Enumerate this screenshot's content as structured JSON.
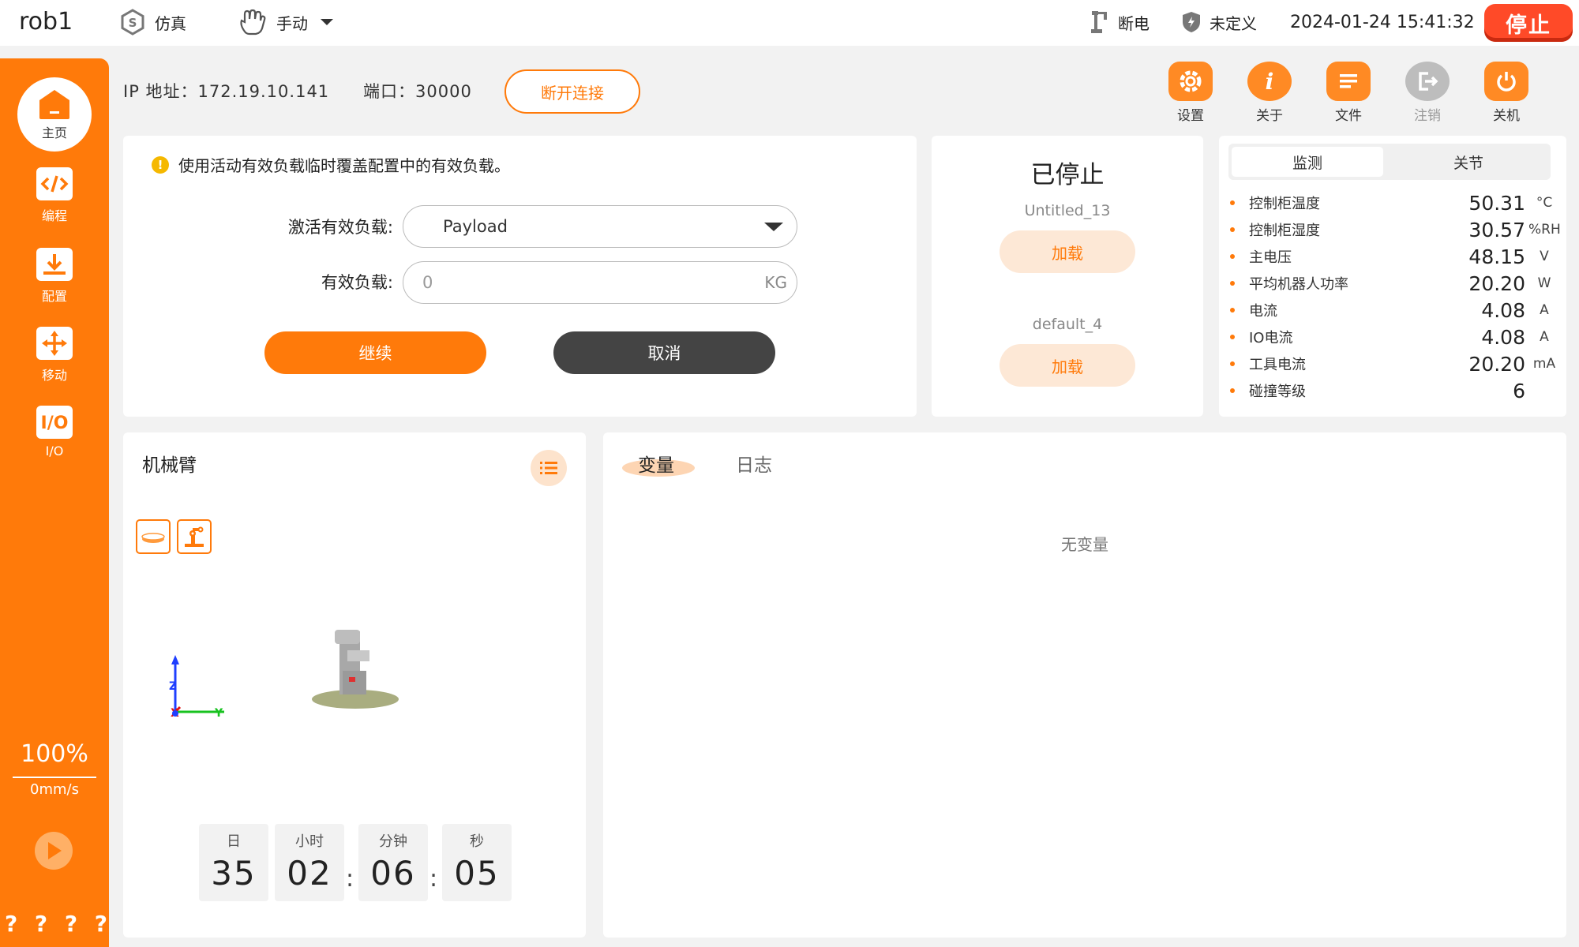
{
  "topbar": {
    "robot_name": "rob1",
    "mode": "仿真",
    "control": "手动",
    "power": "断电",
    "safety": "未定义",
    "datetime": "2024-01-24 15:41:32",
    "stop_label": "停止"
  },
  "sidebar": {
    "items": [
      {
        "label": "主页",
        "icon": "home-icon"
      },
      {
        "label": "编程",
        "icon": "code-icon"
      },
      {
        "label": "配置",
        "icon": "config-icon"
      },
      {
        "label": "移动",
        "icon": "move-icon"
      },
      {
        "label": "I/O",
        "icon": "io-icon"
      }
    ],
    "speed_percent": "100%",
    "speed_value": "0mm/s",
    "help": [
      "?",
      "?",
      "?",
      "?"
    ]
  },
  "connection": {
    "ip_label": "IP 地址：172.19.10.141",
    "port_label": "端口：30000",
    "disconnect_label": "断开连接"
  },
  "toolbar": [
    {
      "label": "设置",
      "icon": "settings-icon"
    },
    {
      "label": "关于",
      "icon": "info-icon"
    },
    {
      "label": "文件",
      "icon": "file-icon"
    },
    {
      "label": "注销",
      "icon": "logout-icon"
    },
    {
      "label": "关机",
      "icon": "power-icon"
    }
  ],
  "payload": {
    "notice": "使用活动有效负载临时覆盖配置中的有效负载。",
    "active_label": "激活有效负载:",
    "active_value": "Payload",
    "load_label": "有效负载:",
    "load_placeholder": "0",
    "load_unit": "KG",
    "continue_label": "继续",
    "cancel_label": "取消"
  },
  "program": {
    "status": "已停止",
    "items": [
      {
        "name": "Untitled_13",
        "button": "加载"
      },
      {
        "name": "default_4",
        "button": "加载"
      }
    ]
  },
  "monitor": {
    "tabs": [
      "监测",
      "关节"
    ],
    "rows": [
      {
        "label": "控制柜温度",
        "value": "50.31",
        "unit": "°C"
      },
      {
        "label": "控制柜湿度",
        "value": "30.57",
        "unit": "%RH"
      },
      {
        "label": "主电压",
        "value": "48.15",
        "unit": "V"
      },
      {
        "label": "平均机器人功率",
        "value": "20.20",
        "unit": "W"
      },
      {
        "label": "电流",
        "value": "4.08",
        "unit": "A"
      },
      {
        "label": "IO电流",
        "value": "4.08",
        "unit": "A"
      },
      {
        "label": "工具电流",
        "value": "20.20",
        "unit": "mA"
      },
      {
        "label": "碰撞等级",
        "value": "6",
        "unit": ""
      }
    ]
  },
  "arm": {
    "title": "机械臂",
    "axis_z": "Z",
    "axis_x": "X",
    "axis_y": "Y",
    "runtime": {
      "labels": [
        "日",
        "小时",
        "分钟",
        "秒"
      ],
      "values": [
        "35",
        "02",
        "06",
        "05"
      ]
    }
  },
  "variables": {
    "tabs": [
      "变量",
      "日志"
    ],
    "empty": "无变量"
  },
  "colors": {
    "accent": "#ff7a0a",
    "stop": "#ff4a28",
    "dark_button": "#444444"
  }
}
